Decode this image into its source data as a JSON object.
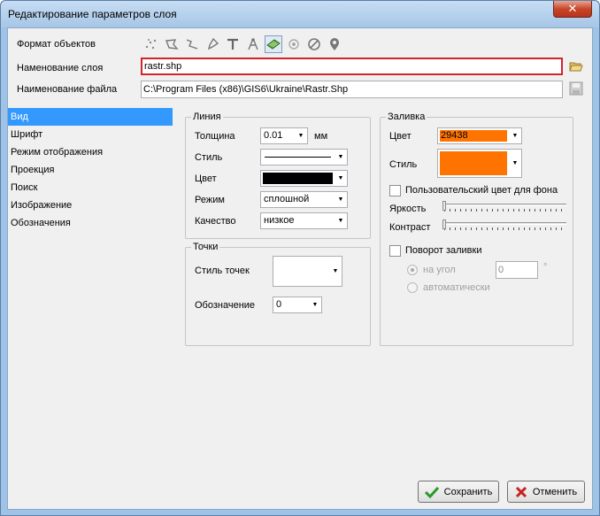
{
  "window": {
    "title": "Редактирование параметров слоя",
    "close_glyph": "✕"
  },
  "header": {
    "format_label": "Формат объектов",
    "layer_name_label": "Наменование слоя",
    "layer_name_value": "rastr.shp",
    "file_name_label": "Наименование файла",
    "file_name_value": "C:\\Program Files (x86)\\GIS6\\Ukraine\\Rastr.Shp",
    "tools": [
      "points-tool-icon",
      "polygon-tool-icon",
      "polyline-tool-icon",
      "pin-tool-icon",
      "text-tool-icon",
      "compass-tool-icon",
      "raster-tool-icon",
      "circle-tool-icon",
      "no-entry-tool-icon",
      "marker-tool-icon"
    ]
  },
  "sidebar": {
    "items": [
      {
        "label": "Вид",
        "selected": true
      },
      {
        "label": "Шрифт"
      },
      {
        "label": "Режим отображения"
      },
      {
        "label": "Проекция"
      },
      {
        "label": "Поиск"
      },
      {
        "label": "Изображение"
      },
      {
        "label": "Обозначения"
      }
    ]
  },
  "line": {
    "title": "Линия",
    "thickness_label": "Толщина",
    "thickness_value": "0.01",
    "thickness_unit": "мм",
    "style_label": "Стиль",
    "color_label": "Цвет",
    "color_value": "#000000",
    "mode_label": "Режим",
    "mode_value": "сплошной",
    "quality_label": "Качество",
    "quality_value": "низкое"
  },
  "points": {
    "title": "Точки",
    "style_label": "Стиль точек",
    "designation_label": "Обозначение",
    "designation_value": "0"
  },
  "fill": {
    "title": "Заливка",
    "color_label": "Цвет",
    "color_value": "29438",
    "color_hex": "#ff7300",
    "style_label": "Стиль",
    "custom_bg_label": "Пользовательский цвет для фона",
    "brightness_label": "Яркость",
    "contrast_label": "Контраст",
    "rotate_label": "Поворот заливки",
    "angle_label": "на угол",
    "angle_value": "0",
    "angle_unit": "°",
    "auto_label": "автоматически"
  },
  "footer": {
    "save_label": "Сохранить",
    "cancel_label": "Отменить"
  }
}
